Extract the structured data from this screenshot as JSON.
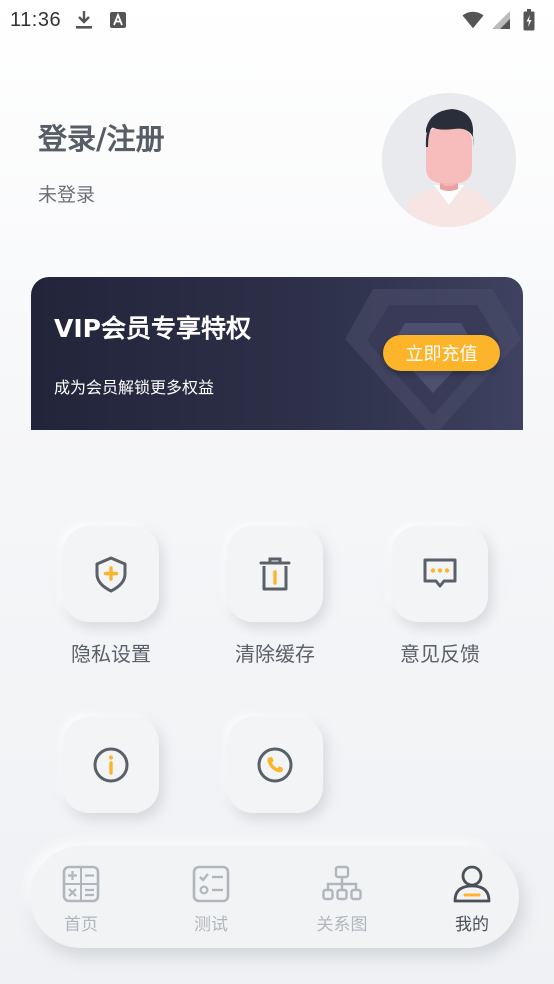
{
  "status_bar": {
    "time": "11:36",
    "left_icons": [
      "download-icon",
      "font-app-icon"
    ],
    "right_icons": [
      "wifi-icon",
      "signal-icon",
      "battery-icon"
    ]
  },
  "profile": {
    "title": "登录/注册",
    "subtitle": "未登录",
    "avatar": "male-avatar"
  },
  "vip_card": {
    "title": "VIP会员专享特权",
    "subtitle": "成为会员解锁更多权益",
    "button_label": "立即充值",
    "accent_color": "#fcb52a",
    "background_color": "#2d3048"
  },
  "features": [
    {
      "label": "隐私设置",
      "icon": "shield-plus-icon"
    },
    {
      "label": "清除缓存",
      "icon": "trash-icon"
    },
    {
      "label": "意见反馈",
      "icon": "message-dots-icon"
    },
    {
      "label": "",
      "icon": "info-icon"
    },
    {
      "label": "",
      "icon": "phone-icon"
    }
  ],
  "bottom_nav": {
    "items": [
      {
        "label": "首页",
        "icon": "calculator-icon",
        "active": false
      },
      {
        "label": "测试",
        "icon": "checklist-icon",
        "active": false
      },
      {
        "label": "关系图",
        "icon": "hierarchy-icon",
        "active": false
      },
      {
        "label": "我的",
        "icon": "user-icon",
        "active": true
      }
    ],
    "active_color": "#fcb52a"
  }
}
